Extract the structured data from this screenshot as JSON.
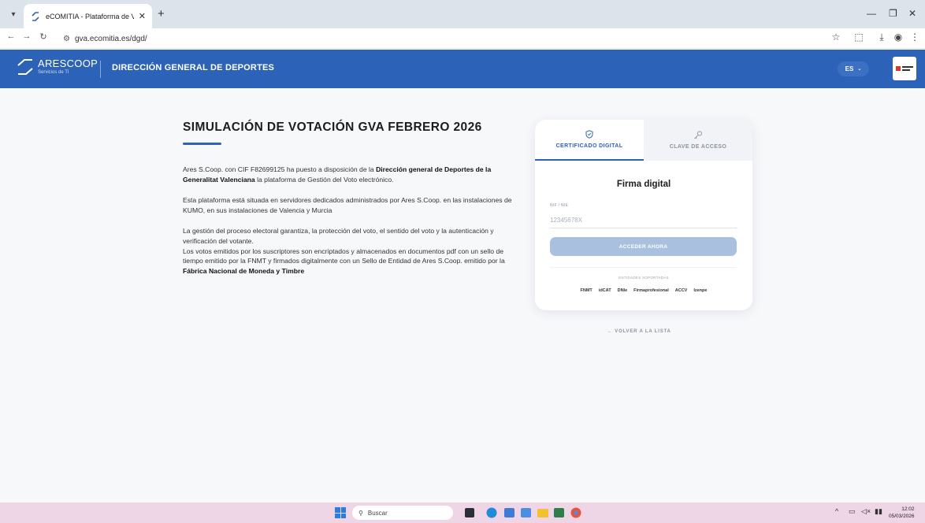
{
  "browser": {
    "tab_title": "eCOMITIA - Plataforma de Voto",
    "url": "gva.ecomitia.es/dgd/"
  },
  "header": {
    "brand": "ARESCOOP",
    "brand_sub": "Servicios de TI",
    "title": "DIRECCIÓN GENERAL DE DEPORTES",
    "language": "ES"
  },
  "main": {
    "title": "SIMULACIÓN DE VOTACIÓN GVA FEBRERO 2026",
    "p1_a": "Ares S.Coop. con CIF F82699125 ha puesto a disposición de la ",
    "p1_b": "Dirección general de Deportes de la Generalitat Valenciana",
    "p1_c": " la plataforma de Gestión del Voto electrónico.",
    "p2": "Esta plataforma está situada en servidores dedicados administrados por Ares S.Coop. en las instalaciones de KUMO, en sus instalaciones de Valencia y Murcia",
    "p3": "La gestión del proceso electoral garantiza, la protección del voto, el sentido del voto y la autenticación y verificación del votante.",
    "p4_a": "Los votos emitidos por los suscriptores son encriptados y almacenados en documentos pdf con un sello de tiempo emitido por la FNMT y firmados digitalmente con un Sello de Entidad de Ares S.Coop. emitido por la ",
    "p4_b": "Fábrica Nacional de Moneda y Timbre"
  },
  "card": {
    "tab_active": "CERTIFICADO DIGITAL",
    "tab_inactive": "CLAVE DE ACCESO",
    "heading": "Firma digital",
    "field_label": "NIF / NIE",
    "field_placeholder": "12345678X",
    "submit": "ACCEDER AHORA",
    "entities_title": "ENTIDADES SOPORTADAS",
    "entities": [
      "FNMT",
      "idCAT",
      "DNIe",
      "Firmaprofesional",
      "ACCV",
      "Izenpe"
    ]
  },
  "back_link": "← VOLVER A LA LISTA",
  "taskbar": {
    "search": "Buscar",
    "time": "12:02",
    "date": "05/03/2026"
  }
}
